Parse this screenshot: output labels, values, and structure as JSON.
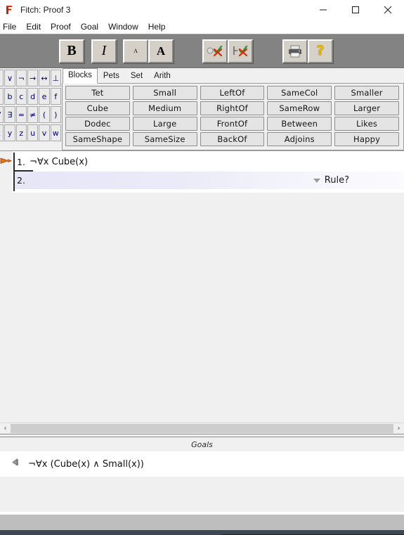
{
  "window": {
    "title": "Fitch: Proof 3",
    "app_icon": "fitch-f-icon",
    "controls": {
      "minimize": "minimize-icon",
      "maximize": "maximize-icon",
      "close": "close-icon"
    }
  },
  "menubar": {
    "items": [
      {
        "label": "File"
      },
      {
        "label": "Edit"
      },
      {
        "label": "Proof"
      },
      {
        "label": "Goal"
      },
      {
        "label": "Window"
      },
      {
        "label": "Help"
      }
    ]
  },
  "toolbar": {
    "bold_label": "B",
    "italic_label": "I",
    "font_small_label": "A",
    "font_large_label": "A",
    "verify_sentence_icon": "check-sentence-icon",
    "verify_proof_icon": "check-proof-icon",
    "print_icon": "printer-icon",
    "help_icon": "question-mark-icon"
  },
  "palette": {
    "rows": [
      [
        "∧",
        "∨",
        "¬",
        "→",
        "↔",
        "⊥"
      ],
      [
        "a",
        "b",
        "c",
        "d",
        "e",
        "f"
      ],
      [
        "∀",
        "∃",
        "=",
        "≠",
        "(",
        ")"
      ],
      [
        "x",
        "y",
        "z",
        "u",
        "v",
        "w"
      ]
    ]
  },
  "tabs": {
    "items": [
      {
        "label": "Blocks",
        "active": true
      },
      {
        "label": "Pets",
        "active": false
      },
      {
        "label": "Set",
        "active": false
      },
      {
        "label": "Arith",
        "active": false
      }
    ]
  },
  "predicate_grid": {
    "rows": [
      [
        "Tet",
        "Small",
        "LeftOf",
        "SameCol",
        "Smaller"
      ],
      [
        "Cube",
        "Medium",
        "RightOf",
        "SameRow",
        "Larger"
      ],
      [
        "Dodec",
        "Large",
        "FrontOf",
        "Between",
        "Likes"
      ],
      [
        "SameShape",
        "SameSize",
        "BackOf",
        "Adjoins",
        "Happy"
      ]
    ]
  },
  "proof": {
    "premise_marker_icon": "orange-flag-icon",
    "lines": [
      {
        "number": "1.",
        "text": "¬∀x Cube(x)",
        "rule": ""
      },
      {
        "number": "2.",
        "text": "",
        "rule": "Rule?"
      }
    ],
    "rule_dropdown_icon": "chevron-down-icon"
  },
  "scrollbar": {
    "left_arrow": "‹",
    "right_arrow": "›"
  },
  "goals": {
    "header": "Goals",
    "items": [
      {
        "icon": "gray-flag-icon",
        "text": "¬∀x (Cube(x) ∧ Small(x))"
      }
    ]
  },
  "colors": {
    "toolbar_bg": "#838383",
    "panel_bg": "#f0f0f0",
    "accent_orange": "#e8701a",
    "selected_row": "#e6e6f7",
    "symbol_blue": "#00007a",
    "statusbar": "#bebebe"
  }
}
